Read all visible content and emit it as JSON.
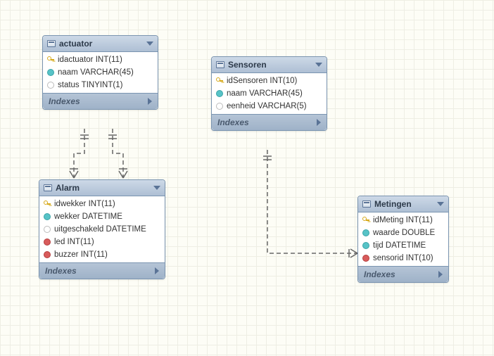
{
  "tables": {
    "actuator": {
      "title": "actuator",
      "indexes_label": "Indexes",
      "columns": [
        {
          "name": "idactuator INT(11)",
          "icon": "key"
        },
        {
          "name": "naam VARCHAR(45)",
          "icon": "cyan"
        },
        {
          "name": "status TINYINT(1)",
          "icon": "white"
        }
      ]
    },
    "sensoren": {
      "title": "Sensoren",
      "indexes_label": "Indexes",
      "columns": [
        {
          "name": "idSensoren INT(10)",
          "icon": "key"
        },
        {
          "name": "naam VARCHAR(45)",
          "icon": "cyan"
        },
        {
          "name": "eenheid VARCHAR(5)",
          "icon": "white"
        }
      ]
    },
    "alarm": {
      "title": "Alarm",
      "indexes_label": "Indexes",
      "columns": [
        {
          "name": "idwekker INT(11)",
          "icon": "key"
        },
        {
          "name": "wekker DATETIME",
          "icon": "cyan"
        },
        {
          "name": "uitgeschakeld DATETIME",
          "icon": "white"
        },
        {
          "name": "led INT(11)",
          "icon": "red"
        },
        {
          "name": "buzzer INT(11)",
          "icon": "red"
        }
      ]
    },
    "metingen": {
      "title": "Metingen",
      "indexes_label": "Indexes",
      "columns": [
        {
          "name": "idMeting INT(11)",
          "icon": "key"
        },
        {
          "name": "waarde DOUBLE",
          "icon": "cyan"
        },
        {
          "name": "tijd DATETIME",
          "icon": "cyan"
        },
        {
          "name": "sensorid INT(10)",
          "icon": "red"
        }
      ]
    }
  },
  "relationships": [
    {
      "from": "actuator",
      "to": "Alarm",
      "type": "one-to-many"
    },
    {
      "from": "actuator",
      "to": "Alarm",
      "type": "one-to-many"
    },
    {
      "from": "Sensoren",
      "to": "Metingen",
      "type": "one-to-many"
    }
  ]
}
